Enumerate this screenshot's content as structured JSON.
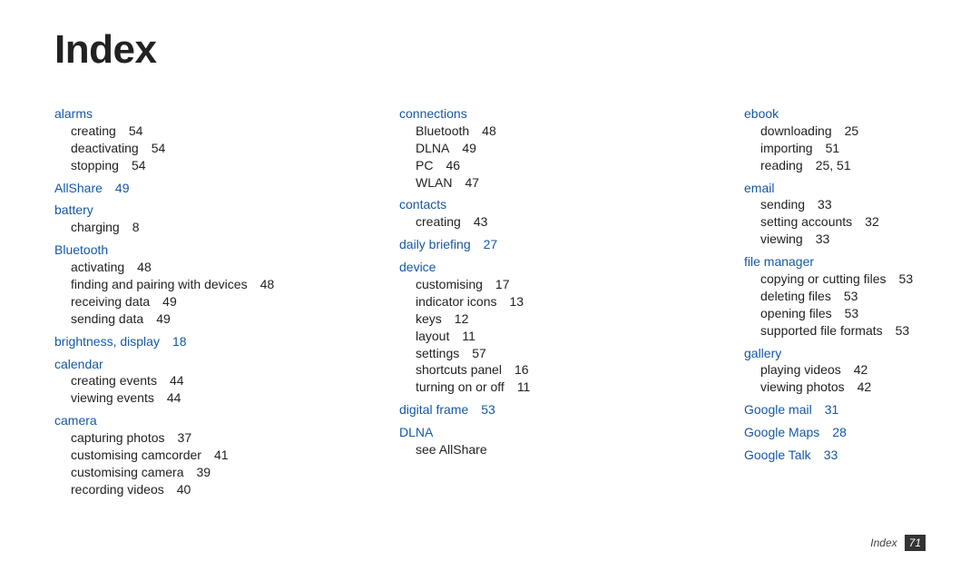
{
  "title": "Index",
  "footer": {
    "label": "Index",
    "page": "71"
  },
  "columns": [
    [
      {
        "type": "term",
        "text": "alarms"
      },
      {
        "type": "sub",
        "label": "creating",
        "page": "54"
      },
      {
        "type": "sub",
        "label": "deactivating",
        "page": "54"
      },
      {
        "type": "sub",
        "label": "stopping",
        "page": "54"
      },
      {
        "type": "term",
        "text": "AllShare",
        "page": "49"
      },
      {
        "type": "term",
        "text": "battery"
      },
      {
        "type": "sub",
        "label": "charging",
        "page": "8"
      },
      {
        "type": "term",
        "text": "Bluetooth"
      },
      {
        "type": "sub",
        "label": "activating",
        "page": "48"
      },
      {
        "type": "sub",
        "label": "finding and pairing with devices",
        "page": "48"
      },
      {
        "type": "sub",
        "label": "receiving data",
        "page": "49"
      },
      {
        "type": "sub",
        "label": "sending data",
        "page": "49"
      },
      {
        "type": "term",
        "text": "brightness, display",
        "page": "18"
      },
      {
        "type": "term",
        "text": "calendar"
      },
      {
        "type": "sub",
        "label": "creating events",
        "page": "44"
      },
      {
        "type": "sub",
        "label": "viewing events",
        "page": "44"
      },
      {
        "type": "term",
        "text": "camera"
      },
      {
        "type": "sub",
        "label": "capturing photos",
        "page": "37"
      },
      {
        "type": "sub",
        "label": "customising camcorder",
        "page": "41"
      },
      {
        "type": "sub",
        "label": "customising camera",
        "page": "39"
      },
      {
        "type": "sub",
        "label": "recording videos",
        "page": "40"
      }
    ],
    [
      {
        "type": "term",
        "text": "connections"
      },
      {
        "type": "sub",
        "label": "Bluetooth",
        "page": "48"
      },
      {
        "type": "sub",
        "label": "DLNA",
        "page": "49"
      },
      {
        "type": "sub",
        "label": "PC",
        "page": "46"
      },
      {
        "type": "sub",
        "label": "WLAN",
        "page": "47"
      },
      {
        "type": "term",
        "text": "contacts"
      },
      {
        "type": "sub",
        "label": "creating",
        "page": "43"
      },
      {
        "type": "term",
        "text": "daily briefing",
        "page": "27"
      },
      {
        "type": "term",
        "text": "device"
      },
      {
        "type": "sub",
        "label": "customising",
        "page": "17"
      },
      {
        "type": "sub",
        "label": "indicator icons",
        "page": "13"
      },
      {
        "type": "sub",
        "label": "keys",
        "page": "12"
      },
      {
        "type": "sub",
        "label": "layout",
        "page": "11"
      },
      {
        "type": "sub",
        "label": "settings",
        "page": "57"
      },
      {
        "type": "sub",
        "label": "shortcuts panel",
        "page": "16"
      },
      {
        "type": "sub",
        "label": "turning on or off",
        "page": "11"
      },
      {
        "type": "term",
        "text": "digital frame",
        "page": "53"
      },
      {
        "type": "term",
        "text": "DLNA"
      },
      {
        "type": "sub",
        "label": "see AllShare"
      }
    ],
    [
      {
        "type": "term",
        "text": "ebook"
      },
      {
        "type": "sub",
        "label": "downloading",
        "page": "25"
      },
      {
        "type": "sub",
        "label": "importing",
        "page": "51"
      },
      {
        "type": "sub",
        "label": "reading",
        "page": "25, 51"
      },
      {
        "type": "term",
        "text": "email"
      },
      {
        "type": "sub",
        "label": "sending",
        "page": "33"
      },
      {
        "type": "sub",
        "label": "setting accounts",
        "page": "32"
      },
      {
        "type": "sub",
        "label": "viewing",
        "page": "33"
      },
      {
        "type": "term",
        "text": "file manager"
      },
      {
        "type": "sub",
        "label": "copying or cutting files",
        "page": "53"
      },
      {
        "type": "sub",
        "label": "deleting files",
        "page": "53"
      },
      {
        "type": "sub",
        "label": "opening files",
        "page": "53"
      },
      {
        "type": "sub",
        "label": "supported file formats",
        "page": "53"
      },
      {
        "type": "term",
        "text": "gallery"
      },
      {
        "type": "sub",
        "label": "playing videos",
        "page": "42"
      },
      {
        "type": "sub",
        "label": "viewing photos",
        "page": "42"
      },
      {
        "type": "term",
        "text": "Google mail",
        "page": "31"
      },
      {
        "type": "term",
        "text": "Google Maps",
        "page": "28"
      },
      {
        "type": "term",
        "text": "Google Talk",
        "page": "33"
      }
    ]
  ]
}
